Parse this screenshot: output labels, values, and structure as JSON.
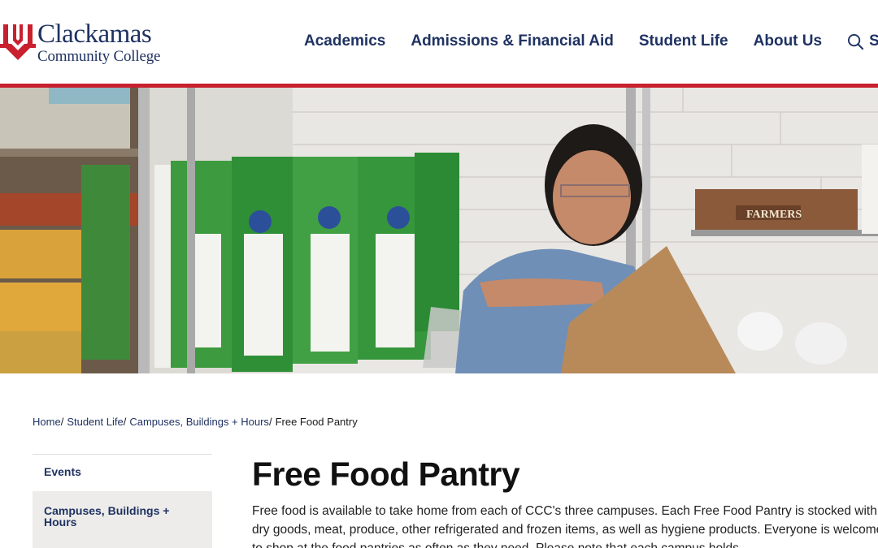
{
  "brand": {
    "name_line1": "Clackamas",
    "name_line2": "Community College",
    "primary_color": "#1f3262",
    "accent_color": "#c8202f"
  },
  "nav": {
    "items": [
      {
        "label": "Academics"
      },
      {
        "label": "Admissions & Financial Aid"
      },
      {
        "label": "Student Life"
      },
      {
        "label": "About Us"
      }
    ],
    "search": {
      "label": "Search",
      "icon": "search-icon"
    }
  },
  "hero": {
    "image_text": {
      "crate_label": "FARMERS"
    }
  },
  "breadcrumb": {
    "items": [
      {
        "label": "Home"
      },
      {
        "label": "Student Life"
      },
      {
        "label": "Campuses, Buildings + Hours"
      }
    ],
    "separator": "/",
    "current": "Free Food Pantry"
  },
  "sidenav": {
    "items": [
      {
        "label": "Events"
      },
      {
        "label": "Campuses, Buildings + Hours"
      }
    ]
  },
  "main": {
    "title": "Free Food Pantry",
    "intro": "Free food is available to take home from each of CCC's three campuses. Each Free Food Pantry is stocked with dry goods, meat, produce, other refrigerated and frozen items, as well as hygiene products. Everyone is welcome to shop at the food pantries as often as they need. Please note that each campus holds"
  }
}
